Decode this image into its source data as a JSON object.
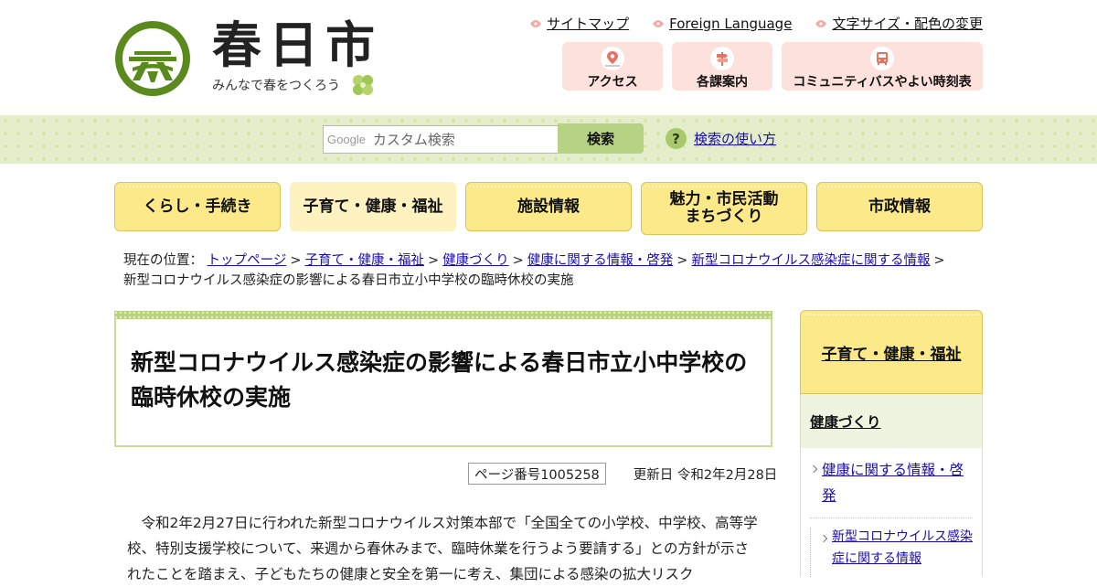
{
  "site": {
    "name": "春日市",
    "slogan": "みんなで春をつくろう",
    "brand_color": "#5a8a1e"
  },
  "utility_links": [
    {
      "label": "サイトマップ",
      "icon": "sakura-icon"
    },
    {
      "label": "Foreign Language",
      "icon": "sakura-icon"
    },
    {
      "label": "文字サイズ・配色の変更",
      "icon": "sakura-icon"
    }
  ],
  "quick_buttons": [
    {
      "label": "アクセス",
      "icon": "map-pin-icon"
    },
    {
      "label": "各課案内",
      "icon": "signpost-icon"
    },
    {
      "label": "コミュニティバスやよい時刻表",
      "icon": "bus-icon"
    }
  ],
  "search": {
    "provider_label": "Google",
    "placeholder": "カスタム検索",
    "button_label": "検索",
    "help_label": "検索の使い方",
    "help_icon_glyph": "?"
  },
  "global_nav": [
    {
      "label": "くらし・手続き"
    },
    {
      "label": "子育て・健康・福祉"
    },
    {
      "label": "施設情報"
    },
    {
      "label_line1": "魅力・市民活動",
      "label_line2": "まちづくり"
    },
    {
      "label": "市政情報"
    }
  ],
  "breadcrumb": {
    "prefix": "現在の位置：",
    "items": [
      "トップページ",
      "子育て・健康・福祉",
      "健康づくり",
      "健康に関する情報・啓発",
      "新型コロナウイルス感染症に関する情報"
    ],
    "current": "新型コロナウイルス感染症の影響による春日市立小中学校の臨時休校の実施",
    "separator": ">"
  },
  "article": {
    "title": "新型コロナウイルス感染症の影響による春日市立小中学校の臨時休校の実施",
    "page_number": "ページ番号1005258",
    "updated": "更新日 令和2年2月28日",
    "body": "令和2年2月27日に行われた新型コロナウイルス対策本部で「全国全ての小学校、中学校、高等学校、特別支援学校について、来週から春休みまで、臨時休業を行うよう要請する」との方針が示されたことを踏まえ、子どもたちの健康と安全を第一に考え、集団による感染の拡大リスク"
  },
  "side_nav": {
    "heading": "子育て・健康・福祉",
    "sub_heading": "健康づくり",
    "items": [
      "健康に関する情報・啓発"
    ],
    "sub_items": [
      "新型コロナウイルス感染症に関する情報"
    ]
  }
}
